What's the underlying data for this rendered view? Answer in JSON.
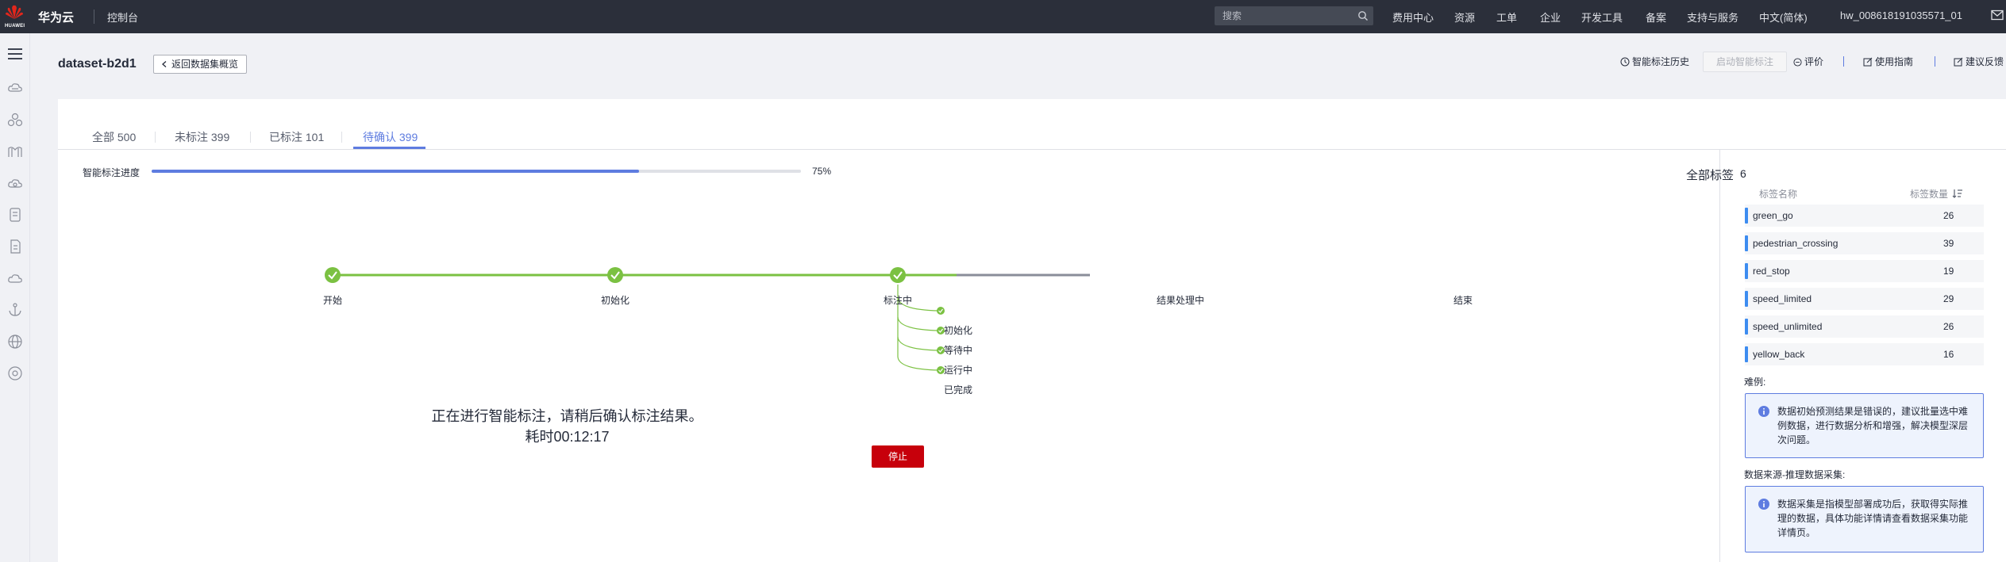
{
  "topbar": {
    "logo_text": "HUAWEI",
    "brand": "华为云",
    "console": "控制台",
    "search_placeholder": "搜索",
    "nav": [
      "费用中心",
      "资源",
      "工单",
      "企业",
      "开发工具",
      "备案",
      "支持与服务",
      "中文(简体)",
      "hw_008618191035571_01"
    ]
  },
  "header": {
    "title": "dataset-b2d1",
    "back_label": "返回数据集概览",
    "actions": {
      "history": "智能标注历史",
      "start": "启动智能标注",
      "rate": "评价",
      "guide": "使用指南",
      "feedback": "建议反馈"
    }
  },
  "tabs": [
    {
      "label": "全部 500"
    },
    {
      "label": "未标注 399"
    },
    {
      "label": "已标注 101"
    },
    {
      "label": "待确认 399"
    }
  ],
  "progress": {
    "label": "智能标注进度",
    "value": 75,
    "text": "75%"
  },
  "flow": {
    "steps": [
      {
        "label": "开始",
        "state": "done"
      },
      {
        "label": "初始化",
        "state": "done"
      },
      {
        "label": "标注中",
        "state": "done"
      },
      {
        "label": "结果处理中",
        "state": "running"
      },
      {
        "label": "结束",
        "state": "pending"
      }
    ],
    "substeps": [
      "初始化",
      "等待中",
      "运行中",
      "已完成"
    ]
  },
  "status": {
    "message": "正在进行智能标注，请稍后确认标注结果。",
    "elapsed": "耗时00:12:17",
    "stop_label": "停止"
  },
  "labels_panel": {
    "title": "全部标签",
    "count": "6",
    "col_name": "标签名称",
    "col_count": "标签数量",
    "rows": [
      {
        "name": "green_go",
        "count": "26"
      },
      {
        "name": "pedestrian_crossing",
        "count": "39"
      },
      {
        "name": "red_stop",
        "count": "19"
      },
      {
        "name": "speed_limited",
        "count": "29"
      },
      {
        "name": "speed_unlimited",
        "count": "26"
      },
      {
        "name": "yellow_back",
        "count": "16"
      }
    ],
    "hard_examples_title": "难例:",
    "hard_examples_text": "数据初始预测结果是错误的，建议批量选中难例数据，进行数据分析和增强，解决模型深层次问题。",
    "source_title": "数据来源-推理数据采集:",
    "source_text": "数据采集是指模型部署成功后，获取得实际推理的数据，具体功能详情请查看数据采集功能详情页。"
  },
  "colors": {
    "topbar": "#2b2f3a",
    "accent": "#5e7ce0",
    "success": "#7bc142",
    "danger": "#c7000b",
    "label_bar": "#3d8cf0"
  }
}
